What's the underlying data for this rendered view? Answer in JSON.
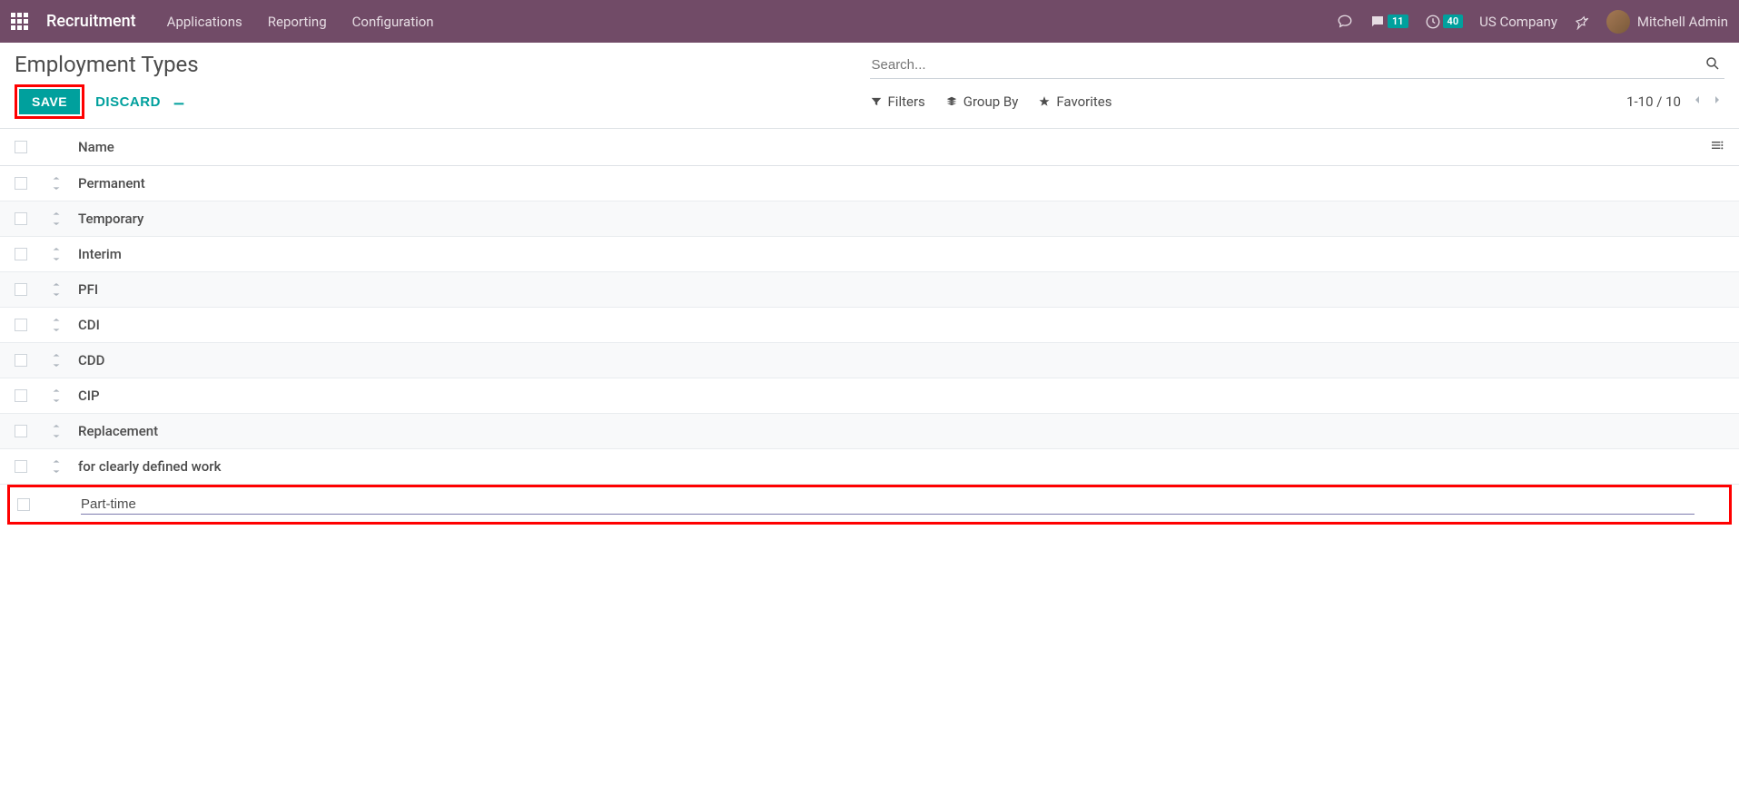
{
  "navbar": {
    "brand": "Recruitment",
    "links": [
      "Applications",
      "Reporting",
      "Configuration"
    ],
    "messages_badge": "11",
    "activities_badge": "40",
    "company": "US Company",
    "user": "Mitchell Admin"
  },
  "cp": {
    "title": "Employment Types",
    "search_placeholder": "Search...",
    "save_label": "SAVE",
    "discard_label": "DISCARD",
    "filters_label": "Filters",
    "groupby_label": "Group By",
    "favorites_label": "Favorites",
    "pager": "1-10 / 10"
  },
  "list": {
    "header_name": "Name",
    "rows": [
      "Permanent",
      "Temporary",
      "Interim",
      "PFI",
      "CDI",
      "CDD",
      "CIP",
      "Replacement",
      "for clearly defined work"
    ],
    "new_row_value": "Part-time"
  }
}
